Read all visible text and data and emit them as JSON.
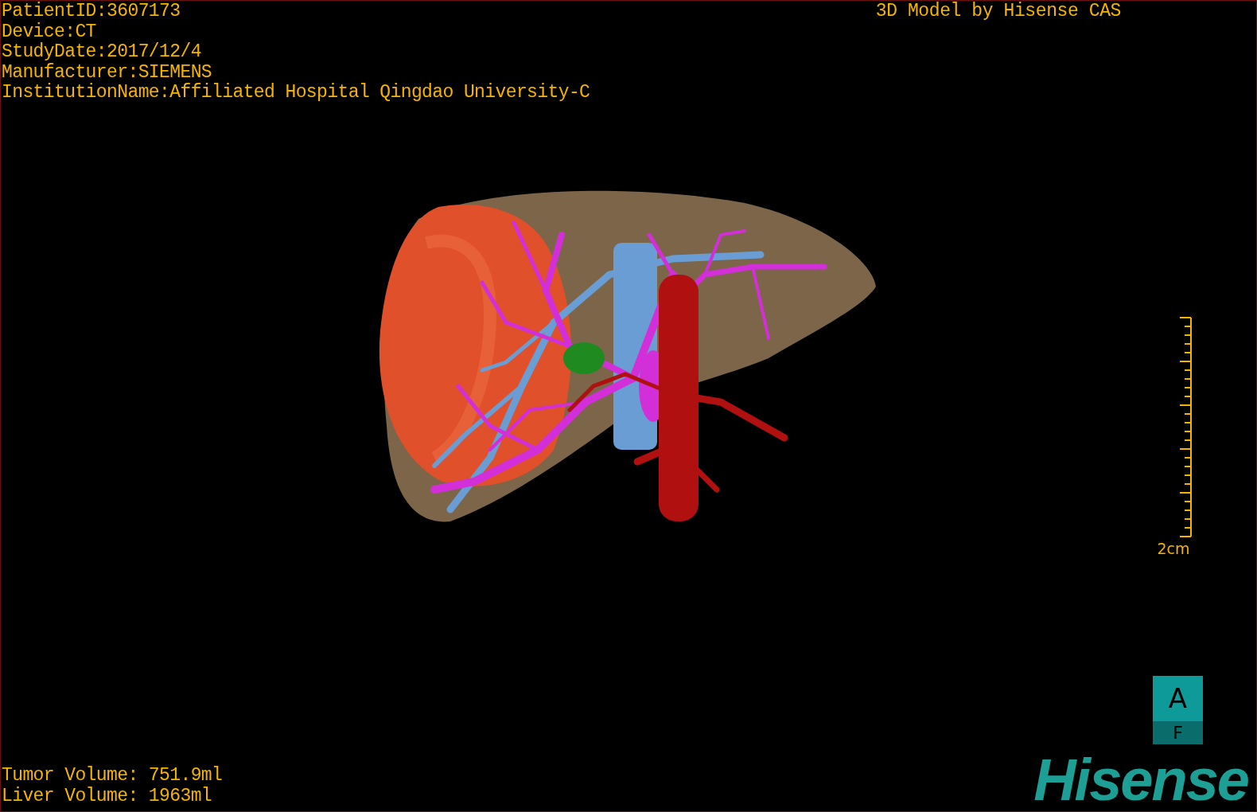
{
  "patient_info": [
    "PatientID:3607173",
    "Device:CT",
    "StudyDate:2017/12/4",
    "Manufacturer:SIEMENS",
    "InstitutionName:Affiliated Hospital Qingdao University-C"
  ],
  "viewer_title": "3D Model by Hisense CAS",
  "scale_bar": {
    "label": "2cm"
  },
  "volumes": [
    "Tumor Volume: 751.9ml",
    "Liver Volume: 1963ml"
  ],
  "orientation_cube": {
    "front": "A",
    "bottom": "F"
  },
  "logo": "Hisense"
}
